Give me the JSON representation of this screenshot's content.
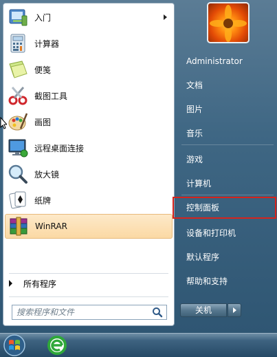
{
  "programs": [
    {
      "label": "入门",
      "icon": "getting-started-icon",
      "has_submenu": true
    },
    {
      "label": "计算器",
      "icon": "calculator-icon"
    },
    {
      "label": "便笺",
      "icon": "sticky-notes-icon"
    },
    {
      "label": "截图工具",
      "icon": "snipping-tool-icon"
    },
    {
      "label": "画图",
      "icon": "paint-icon"
    },
    {
      "label": "远程桌面连接",
      "icon": "remote-desktop-icon"
    },
    {
      "label": "放大镜",
      "icon": "magnifier-icon"
    },
    {
      "label": "纸牌",
      "icon": "solitaire-icon"
    },
    {
      "label": "WinRAR",
      "icon": "winrar-icon",
      "highlighted": true
    }
  ],
  "all_programs_label": "所有程序",
  "search": {
    "placeholder": "搜索程序和文件",
    "value": ""
  },
  "right_items": [
    {
      "label": "Administrator"
    },
    {
      "label": "文档"
    },
    {
      "label": "图片"
    },
    {
      "label": "音乐"
    },
    {
      "label": "游戏"
    },
    {
      "label": "计算机"
    },
    {
      "label": "控制面板",
      "highlighted_box": true
    },
    {
      "label": "设备和打印机"
    },
    {
      "label": "默认程序"
    },
    {
      "label": "帮助和支持"
    }
  ],
  "shutdown": {
    "label": "关机"
  },
  "colors": {
    "highlight_border": "#d6231c",
    "selected_item": "#fbd9a4"
  }
}
